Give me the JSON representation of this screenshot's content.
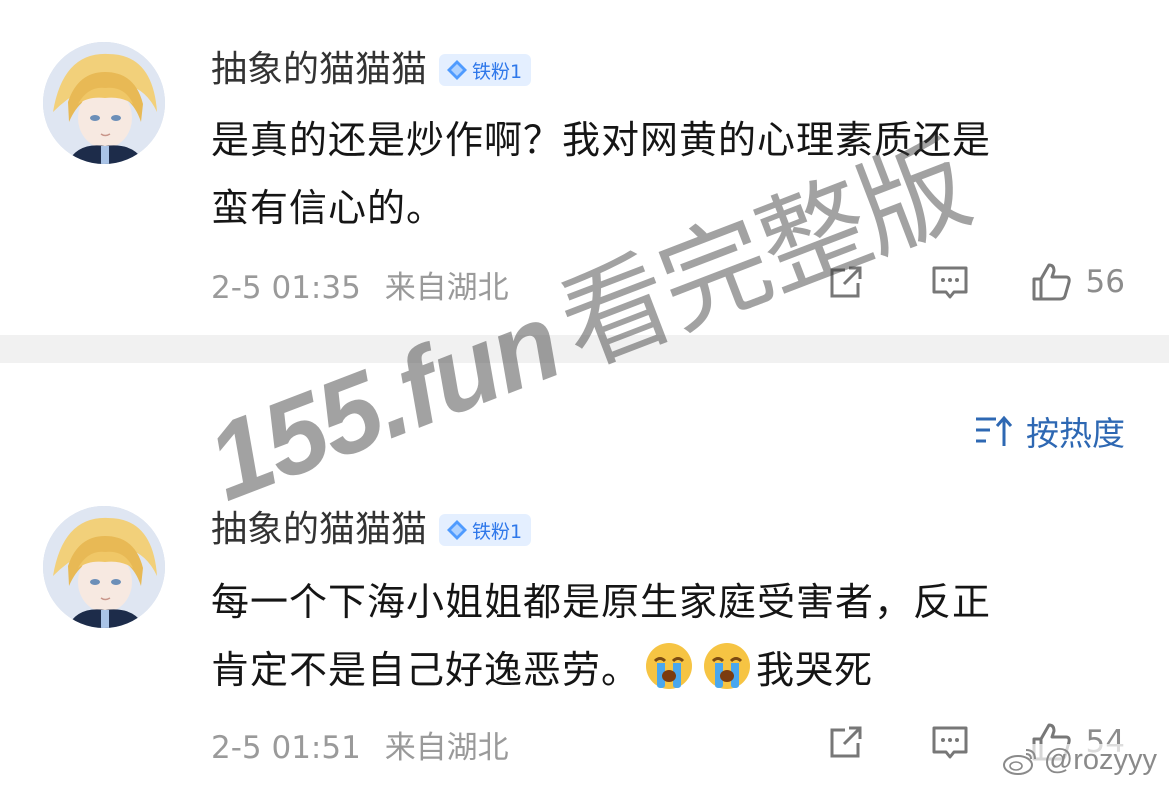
{
  "comments": [
    {
      "author": "抽象的猫猫猫",
      "badge": "铁粉1",
      "lines": [
        "是真的还是炒作啊？我对网黄的心理素质还是",
        "蛮有信心的。"
      ],
      "timestamp": "2-5 01:35",
      "location": "来自湖北",
      "likes": "56"
    },
    {
      "author": "抽象的猫猫猫",
      "badge": "铁粉1",
      "lines": [
        "每一个下海小姐姐都是原生家庭受害者，反正",
        "肯定不是自己好逸恶劳。"
      ],
      "line2_suffix": "我哭死",
      "emojis": [
        "crying-face-icon",
        "crying-face-icon"
      ],
      "timestamp": "2-5 01:51",
      "location": "来自湖北",
      "likes": "54"
    }
  ],
  "sort": {
    "label": "按热度"
  },
  "watermark": {
    "site": "155.fun",
    "text": "看完整版"
  },
  "weibo_handle": "@rozyyy",
  "icons": [
    "share-icon",
    "reply-icon",
    "like-icon",
    "sort-icon",
    "fan-badge-icon",
    "weibo-logo-icon"
  ],
  "colors": {
    "badge_text": "#2f78ea",
    "badge_bg": "#e4efff",
    "link_blue": "#2e68b3",
    "meta_gray": "#9a9a9a",
    "divider_gray": "#f1f1f1"
  }
}
